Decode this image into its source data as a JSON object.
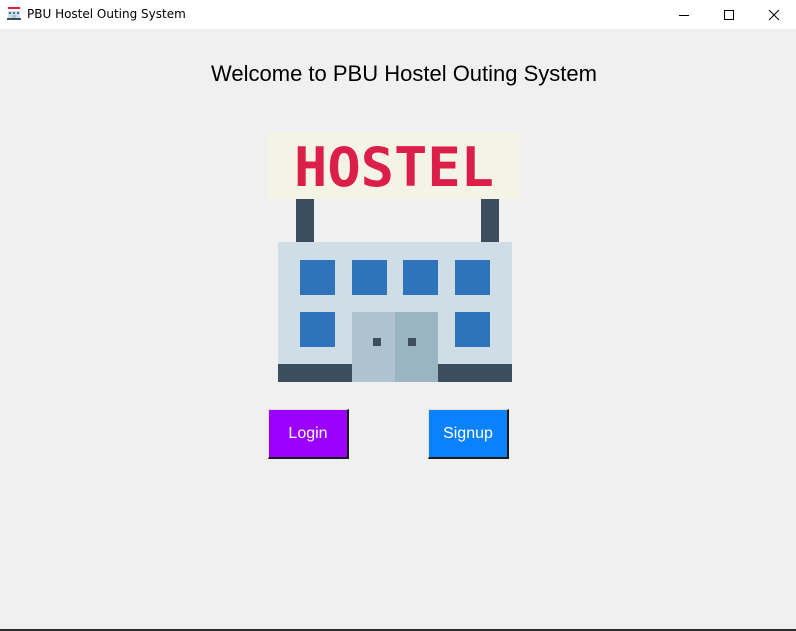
{
  "window": {
    "title": "PBU Hostel Outing System",
    "icons": {
      "app": "hostel-app-icon",
      "minimize": "minimize-icon",
      "maximize": "maximize-icon",
      "close": "close-icon"
    }
  },
  "main": {
    "heading": "Welcome to PBU Hostel Outing System",
    "image": {
      "name": "hostel-building-illustration",
      "sign_text": "HOSTEL"
    },
    "buttons": {
      "login": {
        "label": "Login",
        "color": "#9b00ff"
      },
      "signup": {
        "label": "Signup",
        "color": "#0a82ff"
      }
    }
  },
  "colors": {
    "background": "#f0f0f0",
    "sign_text": "#dc1e4b",
    "sign_board": "#f3f3e6",
    "building": "#cfdde7",
    "windows": "#2f74bb",
    "door": "#aec3cf",
    "dark": "#3c4e5e"
  }
}
